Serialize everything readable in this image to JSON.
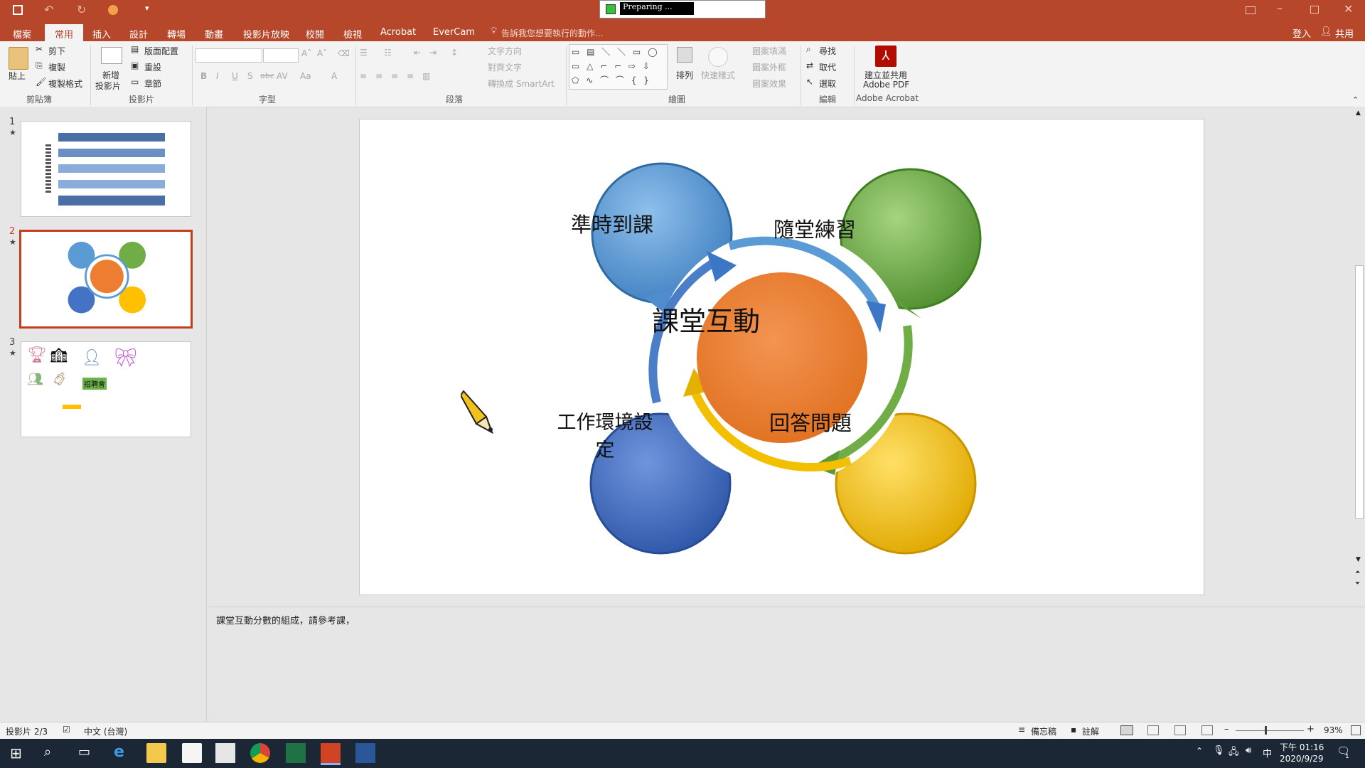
{
  "titlebar": {
    "status_text": "Preparing ...",
    "accent": "#b7472a"
  },
  "tabs": [
    {
      "label": "檔案"
    },
    {
      "label": "常用"
    },
    {
      "label": "插入"
    },
    {
      "label": "設計"
    },
    {
      "label": "轉場"
    },
    {
      "label": "動畫"
    },
    {
      "label": "投影片放映"
    },
    {
      "label": "校閱"
    },
    {
      "label": "檢視"
    },
    {
      "label": "Acrobat"
    },
    {
      "label": "EverCam"
    }
  ],
  "tellme": "告訴我您想要執行的動作...",
  "account": {
    "signin": "登入",
    "share": "共用"
  },
  "ribbon": {
    "clipboard": {
      "paste": "貼上",
      "cut": "剪下",
      "copy": "複製",
      "format_painter": "複製格式",
      "group": "剪貼簿"
    },
    "slides": {
      "new_slide_1": "新增",
      "new_slide_2": "投影片",
      "layout": "版面配置",
      "reset": "重設",
      "section": "章節",
      "group": "投影片"
    },
    "font": {
      "group": "字型",
      "bold": "B",
      "italic": "I",
      "underline": "U",
      "shadow": "S",
      "strike": "abc",
      "spacing": "AV",
      "case": "Aa",
      "color": "A"
    },
    "paragraph": {
      "group": "段落",
      "text_direction": "文字方向",
      "align_text": "對齊文字",
      "smartart": "轉換成 SmartArt"
    },
    "drawing": {
      "group": "繪圖",
      "arrange": "排列",
      "quick_styles": "快速樣式",
      "fill": "圖案填滿",
      "outline": "圖案外框",
      "effects": "圖案效果"
    },
    "editing": {
      "group": "編輯",
      "find": "尋找",
      "replace": "取代",
      "select": "選取"
    },
    "acrobat": {
      "label1": "建立並共用",
      "label2": "Adobe PDF",
      "group": "Adobe Acrobat"
    }
  },
  "thumbnails": [
    {
      "num": "1",
      "star": "★"
    },
    {
      "num": "2",
      "star": "★"
    },
    {
      "num": "3",
      "star": "★"
    }
  ],
  "slide3_badge": "招聘會",
  "slide": {
    "center": "課堂互動",
    "top_left": "準時到課",
    "top_right": "隨堂練習",
    "bottom_left": "工作環境設定",
    "bottom_right": "回答問題",
    "colors": {
      "center": "#ed7d31",
      "top_left": "#5b9bd5",
      "top_right": "#70ad47",
      "bottom_left": "#4472c4",
      "bottom_right": "#ffc000"
    }
  },
  "notes": "課堂互動分數的組成，請參考課，",
  "status": {
    "slide_pos": "投影片 2/3",
    "language": "中文 (台灣)",
    "notes_btn": "備忘稿",
    "comments_btn": "註解",
    "zoom": "93%"
  },
  "taskbar": {
    "time": "下午 01:16",
    "date": "2020/9/29",
    "ime": "中",
    "notify_count": "1"
  }
}
